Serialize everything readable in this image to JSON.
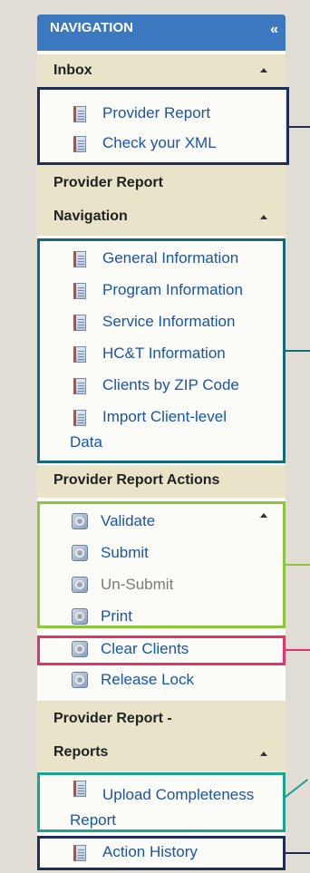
{
  "navigation": {
    "title": "NAVIGATION",
    "collapse_glyph": "«"
  },
  "inbox": {
    "title": "Inbox",
    "items": [
      "Provider Report",
      "Check your XML"
    ]
  },
  "provider_report_navigation": {
    "title_line1": "Provider Report",
    "title_line2": "Navigation",
    "items": [
      "General Information",
      "Program Information",
      "Service Information",
      "HC&T Information",
      "Clients by ZIP Code"
    ],
    "import_line1": "Import Client-level",
    "import_line2": "Data"
  },
  "provider_report_actions": {
    "title": "Provider Report Actions",
    "items": [
      "Validate",
      "Submit",
      "Un-Submit",
      "Print",
      "Clear Clients",
      "Release Lock"
    ]
  },
  "provider_report_reports": {
    "title_line1": "Provider Report -",
    "title_line2": "Reports",
    "upload_line1": "Upload Completeness",
    "upload_line2": "Report",
    "items": [
      "Action History"
    ]
  },
  "colors": {
    "header_blue": "#3b78c0",
    "section_beige": "#e9e3c9",
    "link_blue": "#1a55a8",
    "highlight_navy": "#1d2f57",
    "highlight_teal": "#16697a",
    "highlight_green": "#8cc63f",
    "highlight_pink": "#e0346b",
    "highlight_cyan": "#1aa38f"
  },
  "icons": {
    "report": "report-document-icon",
    "action": "gear-icon",
    "collapse": "double-chevron-left-icon",
    "section_toggle": "chevron-up-icon"
  }
}
